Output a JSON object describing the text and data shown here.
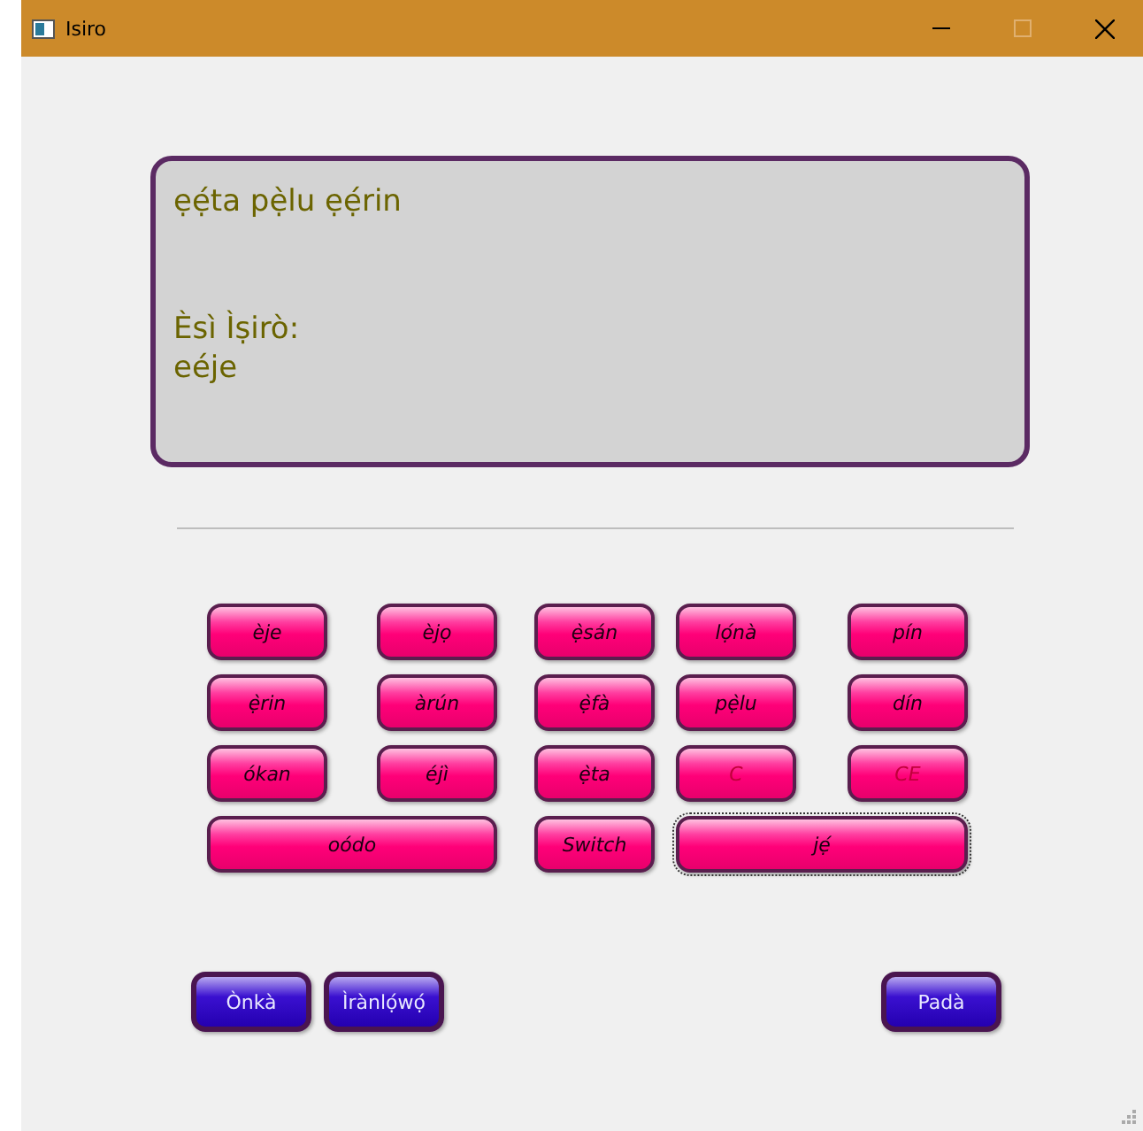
{
  "window": {
    "title": "Isiro",
    "controls": [
      {
        "kind": "minimize",
        "disabled": false
      },
      {
        "kind": "maximize",
        "disabled": true
      },
      {
        "kind": "close",
        "disabled": false
      }
    ]
  },
  "display": {
    "expression": "ẹẹ́ta pẹ̀lu ẹẹ́rin",
    "result_label": "Èsì Ìṣirò:",
    "result": "eéje"
  },
  "keys": [
    {
      "label": "èje",
      "kind": "word",
      "wide": false,
      "focused": false
    },
    {
      "label": "èjọ",
      "kind": "word",
      "wide": false,
      "focused": false
    },
    {
      "label": "ẹ̀sán",
      "kind": "word",
      "wide": false,
      "focused": false
    },
    {
      "label": "lọ́nà",
      "kind": "word",
      "wide": false,
      "focused": false
    },
    {
      "label": "pín",
      "kind": "word",
      "wide": false,
      "focused": false
    },
    {
      "label": "ẹ̀rin",
      "kind": "word",
      "wide": false,
      "focused": false
    },
    {
      "label": "àrún",
      "kind": "word",
      "wide": false,
      "focused": false
    },
    {
      "label": "ẹ̀fà",
      "kind": "word",
      "wide": false,
      "focused": false
    },
    {
      "label": "pẹ̀lu",
      "kind": "word",
      "wide": false,
      "focused": false
    },
    {
      "label": "dín",
      "kind": "word",
      "wide": false,
      "focused": false
    },
    {
      "label": "ókan",
      "kind": "word",
      "wide": false,
      "focused": false
    },
    {
      "label": "éjì",
      "kind": "word",
      "wide": false,
      "focused": false
    },
    {
      "label": "ẹ̀ta",
      "kind": "word",
      "wide": false,
      "focused": false
    },
    {
      "label": "C",
      "kind": "clear",
      "wide": false,
      "focused": false
    },
    {
      "label": "CE",
      "kind": "clear",
      "wide": false,
      "focused": false
    },
    {
      "label": "oódo",
      "kind": "word",
      "wide": true,
      "focused": false
    },
    {
      "label": "Switch",
      "kind": "word",
      "wide": false,
      "focused": false
    },
    {
      "label": "jẹ́",
      "kind": "word",
      "wide": true,
      "focused": true
    }
  ],
  "footer": {
    "left": [
      "Ònkà",
      "Ìrànlọ́wọ́"
    ],
    "right": [
      "Padà"
    ]
  }
}
